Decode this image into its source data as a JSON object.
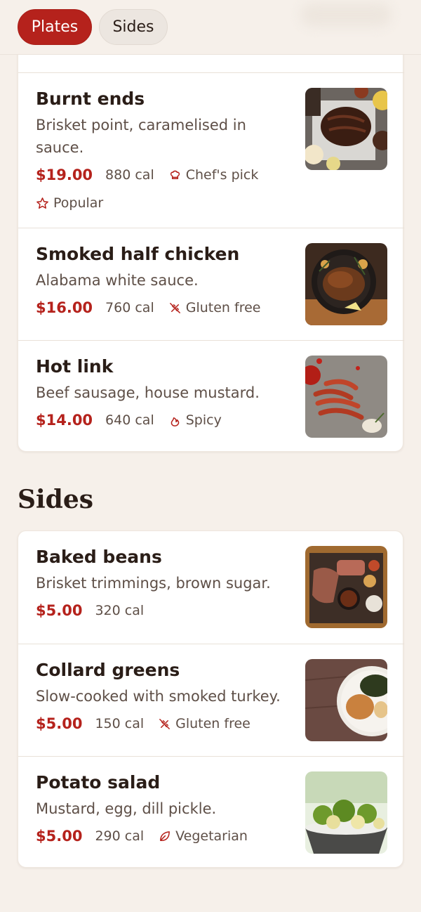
{
  "tabs": [
    {
      "label": "Plates",
      "active": true
    },
    {
      "label": "Sides",
      "active": false
    }
  ],
  "plates": {
    "items": [
      {
        "name": "Burnt ends",
        "description": "Brisket point, caramelised in sauce.",
        "price": "$19.00",
        "calories": "880 cal",
        "tags": [
          {
            "label": "Chef's pick",
            "icon": "chef-hat-icon"
          },
          {
            "label": "Popular",
            "icon": "star-icon"
          }
        ]
      },
      {
        "name": "Smoked half chicken",
        "description": "Alabama white sauce.",
        "price": "$16.00",
        "calories": "760 cal",
        "tags": [
          {
            "label": "Gluten free",
            "icon": "gluten-free-icon"
          }
        ]
      },
      {
        "name": "Hot link",
        "description": "Beef sausage, house mustard.",
        "price": "$14.00",
        "calories": "640 cal",
        "tags": [
          {
            "label": "Spicy",
            "icon": "flame-icon"
          }
        ]
      }
    ]
  },
  "sides": {
    "title": "Sides",
    "items": [
      {
        "name": "Baked beans",
        "description": "Brisket trimmings, brown sugar.",
        "price": "$5.00",
        "calories": "320 cal",
        "tags": []
      },
      {
        "name": "Collard greens",
        "description": "Slow-cooked with smoked turkey.",
        "price": "$5.00",
        "calories": "150 cal",
        "tags": [
          {
            "label": "Gluten free",
            "icon": "gluten-free-icon"
          }
        ]
      },
      {
        "name": "Potato salad",
        "description": "Mustard, egg, dill pickle.",
        "price": "$5.00",
        "calories": "290 cal",
        "tags": [
          {
            "label": "Vegetarian",
            "icon": "leaf-icon"
          }
        ]
      }
    ]
  },
  "colors": {
    "accent": "#b5221c",
    "background": "#f6f0ea",
    "card": "#ffffff",
    "text": "#2a1d17",
    "muted": "#5e4f47"
  }
}
